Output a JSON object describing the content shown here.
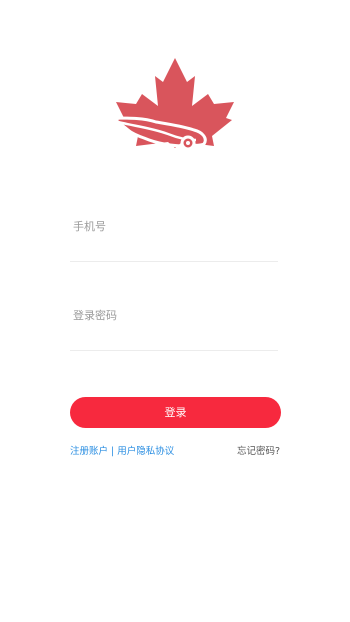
{
  "logo": {
    "icon": "maple-leaf-car-logo-icon",
    "colors": {
      "leaf": "#d9555c",
      "car": "#ffffff"
    }
  },
  "form": {
    "phone_placeholder": "手机号",
    "password_placeholder": "登录密码",
    "login_label": "登录"
  },
  "links": {
    "register_label": "注册账户",
    "separator": " | ",
    "privacy_label": "用户隐私协议",
    "forgot_label": "忘记密码?"
  },
  "colors": {
    "accent": "#f7293e",
    "link": "#2a8ee2",
    "divider": "#ececec"
  }
}
